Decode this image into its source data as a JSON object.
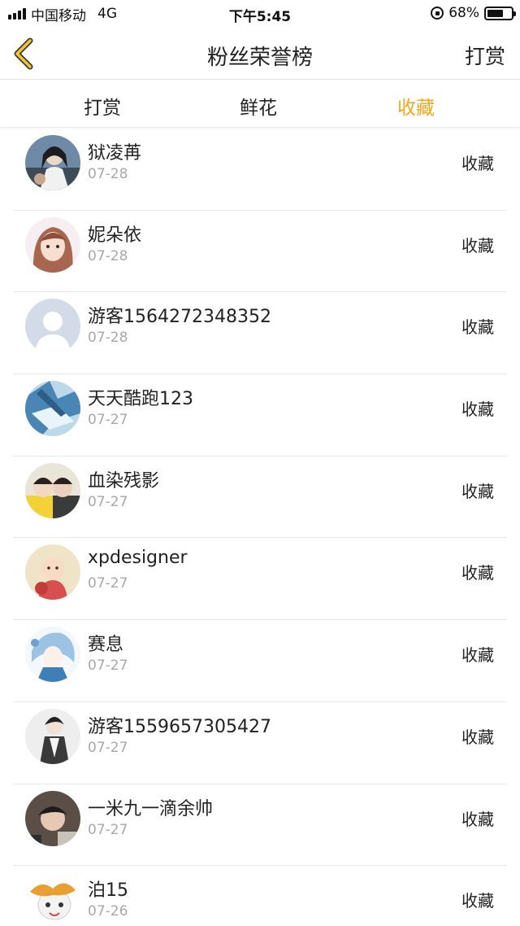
{
  "status_bar": {
    "carrier": "中国移动",
    "network": "4G",
    "time": "下午5:45",
    "battery": "68%",
    "battery_level": 0.68
  },
  "nav": {
    "title": "粉丝荣誉榜",
    "action_label": "打赏",
    "accent_color": "#f0a81c"
  },
  "tabs": [
    {
      "label": "打赏",
      "active": false
    },
    {
      "label": "鲜花",
      "active": false
    },
    {
      "label": "收藏",
      "active": true
    }
  ],
  "fans": [
    {
      "name": "狱凌苒",
      "date": "07-28",
      "type": "收藏"
    },
    {
      "name": "妮朵依",
      "date": "07-28",
      "type": "收藏"
    },
    {
      "name": "游客1564272348352",
      "date": "07-28",
      "type": "收藏"
    },
    {
      "name": "天天酷跑123",
      "date": "07-27",
      "type": "收藏"
    },
    {
      "name": "血染残影",
      "date": "07-27",
      "type": "收藏"
    },
    {
      "name": "xpdesigner",
      "date": "07-27",
      "type": "收藏"
    },
    {
      "name": "赛息",
      "date": "07-27",
      "type": "收藏"
    },
    {
      "name": "游客1559657305427",
      "date": "07-27",
      "type": "收藏"
    },
    {
      "name": "一米九一滴余帅",
      "date": "07-27",
      "type": "收藏"
    },
    {
      "name": "泊15",
      "date": "07-26",
      "type": "收藏"
    }
  ]
}
